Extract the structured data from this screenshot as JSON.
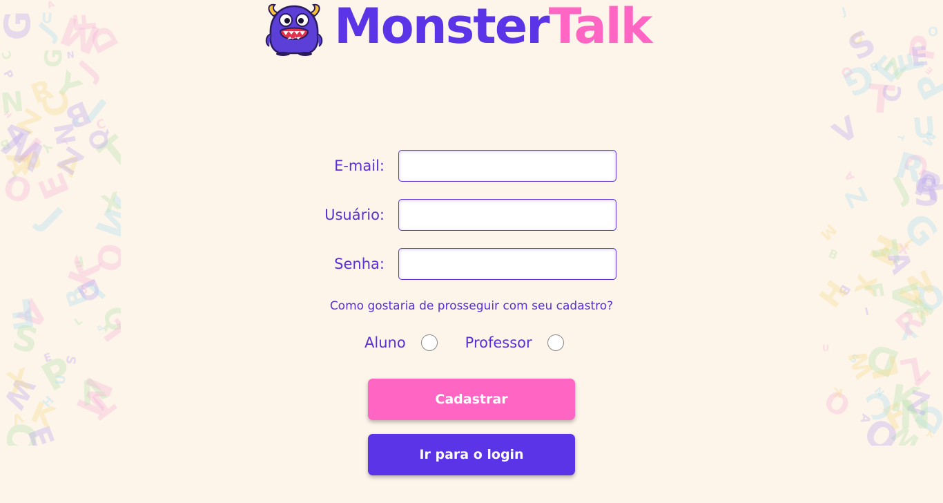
{
  "brand": {
    "name_part1": "Monster",
    "name_part2": "Talk",
    "logo_icon": "monster-mascot-icon",
    "color_primary": "#5b34e8",
    "color_accent": "#ff66c4"
  },
  "form": {
    "email_label": "E-mail:",
    "email_value": "",
    "username_label": "Usuário:",
    "username_value": "",
    "password_label": "Senha:",
    "password_value": "",
    "question": "Como gostaria de prosseguir com seu cadastro?",
    "options": [
      {
        "label": "Aluno",
        "selected": false
      },
      {
        "label": "Professor",
        "selected": false
      }
    ],
    "register_button": "Cadastrar",
    "login_button": "Ir para o login"
  },
  "background": {
    "left_letters": [
      "L",
      "B",
      "N",
      "W",
      "A",
      "J",
      "C",
      "E",
      "D",
      "F",
      "R",
      "T",
      "P",
      "I",
      "S",
      "O",
      "A",
      "Z",
      "M",
      "Q",
      "K",
      "G",
      "Y",
      "X",
      "H",
      "V",
      "U"
    ],
    "right_letters": [
      "M",
      "O",
      "S",
      "P",
      "A",
      "I",
      "R",
      "F",
      "D",
      "T",
      "L",
      "Q",
      "B",
      "N",
      "Z",
      "K",
      "C",
      "E",
      "X",
      "W",
      "Y",
      "G",
      "H",
      "U",
      "V",
      "J"
    ]
  }
}
